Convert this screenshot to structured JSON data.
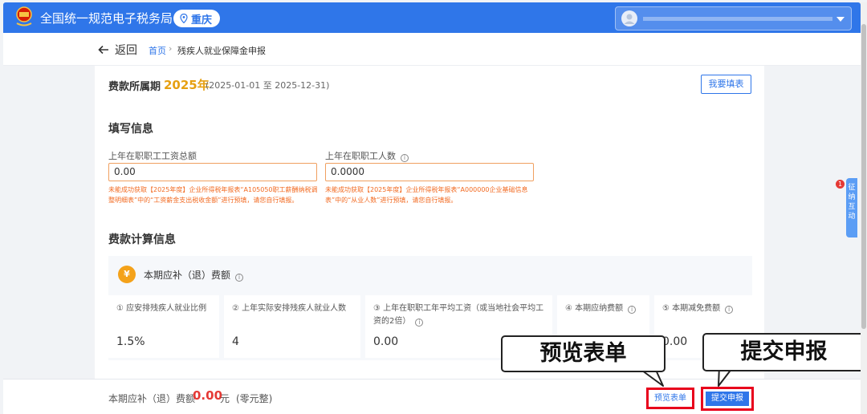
{
  "header": {
    "site_title": "全国统一规范电子税务局",
    "city": "重庆",
    "user_name": ""
  },
  "nav": {
    "back_label": "返回",
    "breadcrumb_home": "首页",
    "breadcrumb_separator": "›",
    "breadcrumb_current": "残疾人就业保障金申报"
  },
  "period": {
    "label": "费款所属期",
    "year": "2025年",
    "range": "(2025-01-01 至 2025-12-31)",
    "fill_button": "我要填表"
  },
  "fill_info": {
    "title": "填写信息",
    "fields": [
      {
        "label": "上年在职职工工资总额",
        "value": "0.00",
        "has_info": false,
        "error": "未能成功获取【2025年度】企业所得税年报表“A105050职工薪酬纳税调整明细表”中的“工资薪金支出税收金额”进行预填，请您自行填报。"
      },
      {
        "label": "上年在职职工人数",
        "value": "0.0000",
        "has_info": true,
        "error": "未能成功获取【2025年度】企业所得税年报表“A000000企业基础信息表”中的“从业人数”进行预填，请您自行填报。"
      }
    ]
  },
  "calc_info": {
    "title": "费款计算信息",
    "panel_label": "本期应补（退）费额",
    "cells": [
      {
        "label": "① 应安排残疾人就业比例",
        "value": "1.5%",
        "has_info": false
      },
      {
        "label": "② 上年实际安排残疾人就业人数",
        "value": "4",
        "has_info": false
      },
      {
        "label": "③ 上年在职职工年平均工资（或当地社会平均工资的2倍）",
        "value": "0.00",
        "has_info": true
      },
      {
        "label": "④ 本期应纳费额",
        "value": "",
        "has_info": true
      },
      {
        "label": "⑤ 本期减免费额",
        "value": "0.00",
        "has_info": true
      }
    ]
  },
  "footer": {
    "label": "本期应补（退）费额",
    "amount": "0.00",
    "unit": "元",
    "amount_words": "(零元整)",
    "preview_button": "预览表单",
    "submit_button": "提交申报"
  },
  "annotations": {
    "preview_callout": "预览表单",
    "submit_callout": "提交申报"
  },
  "side_widget": {
    "label": "征纳互动",
    "badge": "1"
  },
  "colors": {
    "primary": "#2f76e9",
    "accent_orange": "#e6a012",
    "error": "#f26a21",
    "amount_red": "#e53935",
    "highlight_box": "#e8001c"
  }
}
